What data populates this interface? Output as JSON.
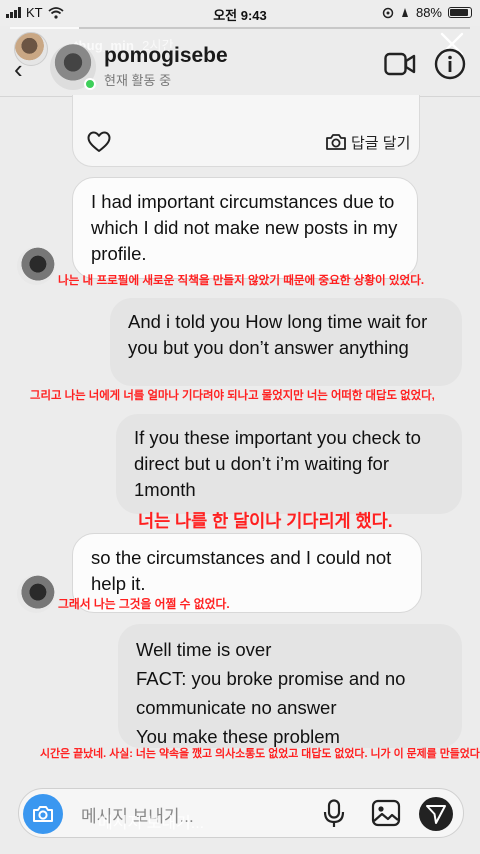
{
  "status_bar": {
    "carrier": "KT",
    "time": "오전 9:43",
    "battery": "88%",
    "battery_level": 0.88
  },
  "story": {
    "username": "thug_min",
    "time_ago": "2시간",
    "progress": 0.15
  },
  "chat_header": {
    "title": "pomogisebe",
    "status": "현재 활동 중"
  },
  "shared_post": {
    "reply_label": "답글 달기"
  },
  "messages": [
    {
      "direction": "in",
      "text": "I had important circumstances due to which I did not make new posts in my profile."
    },
    {
      "direction": "out",
      "text": "And i told you How long time wait for you but you don’t answer anything"
    },
    {
      "direction": "out",
      "text": "If you these important you check to direct but u don’t i’m waiting for 1month"
    },
    {
      "direction": "in",
      "text": "so the circumstances and I could not help it."
    },
    {
      "direction": "out",
      "text": "Well time is over\nFACT: you broke promise and no communicate no answer\nYou make these problem"
    }
  ],
  "captions": [
    "나는 내 프로필에 새로운 직책을 만들지 않았기 때문에 중요한 상황이 있었다.",
    "그리고 나는 너에게 너를 얼마나 기다려야 되나고 물었지만 너는 어떠한 대답도 없었다,",
    "너는 나를 한 달이나 기다리게 했다.",
    "그래서 나는 그것을 어쩔 수 없었다.",
    "시간은 끝났네. 사실: 너는 약속을 깼고 의사소통도 없었고 대답도 없었다. 니가 이 문제를 만들었다."
  ],
  "composer": {
    "placeholder": "메시지 보내기...",
    "story_placeholder": "메시지 보내기..."
  },
  "colors": {
    "caption": "#ff2020",
    "camera_button": "#3a97f0",
    "online_dot": "#3ecf5a"
  }
}
